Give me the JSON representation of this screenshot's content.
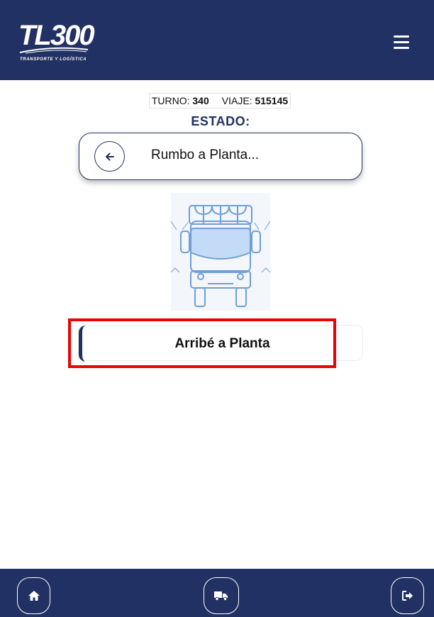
{
  "header": {
    "logo_text": "TL300",
    "logo_subtitle": "TRANSPORTE Y LOGÍSTICA",
    "menu_icon": "hamburger-menu-icon"
  },
  "trip": {
    "turno_label": "TURNO:",
    "turno_value": "340",
    "viaje_label": "VIAJE:",
    "viaje_value": "515145"
  },
  "status": {
    "label": "ESTADO:",
    "current": "Rumbo a Planta...",
    "back_icon": "arrow-left-icon"
  },
  "illustration": "truck-front-illustration",
  "action": {
    "label": "Arribé a Planta"
  },
  "footer": {
    "home_icon": "home-icon",
    "truck_icon": "truck-icon",
    "logout_icon": "logout-icon"
  },
  "colors": {
    "brand": "#223163",
    "highlight": "#ee0000",
    "illustration_line": "#6f9fd8",
    "illustration_fill": "#c3dbf6"
  }
}
